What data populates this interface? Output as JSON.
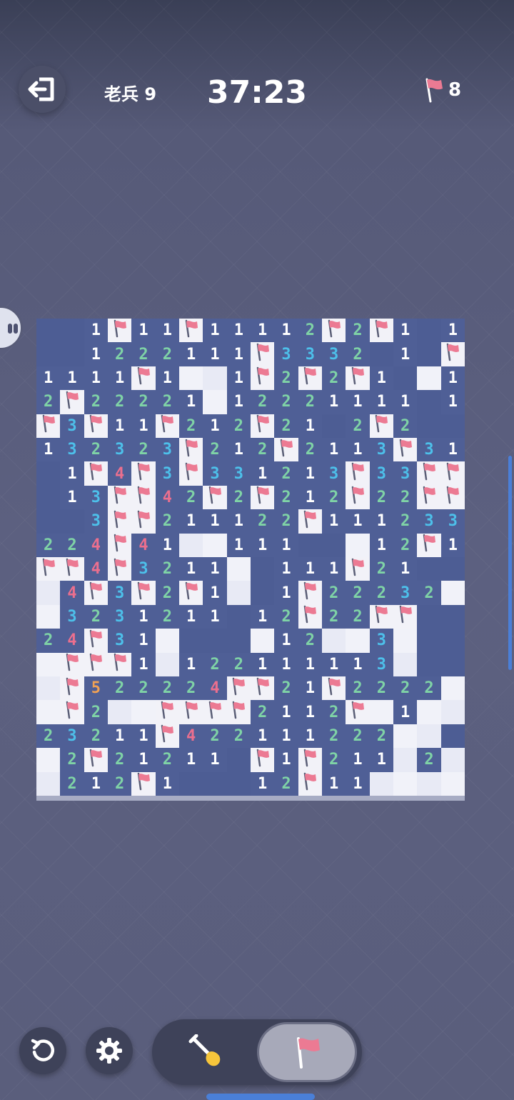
{
  "header": {
    "level_label": "老兵 9",
    "timer": "37:23",
    "flags_remaining": "8"
  },
  "icons": {
    "exit": "exit-arrow-icon",
    "flag": "flag-icon",
    "restart": "restart-icon",
    "settings": "gear-icon",
    "shovel": "shovel-icon",
    "side": "chat-icon"
  },
  "colors": {
    "board_covered": "#4d5d94",
    "cell_open": "#f1f2f9",
    "flag": "#ec7a93",
    "num1": "#ffffff",
    "num2": "#7fd3a6",
    "num3": "#4dc0ea",
    "num4": "#ec6f8e",
    "num5": "#f0a154"
  },
  "mode": {
    "options": [
      "dig",
      "flag"
    ],
    "selected": "flag"
  },
  "board": {
    "cols": 18,
    "rows": 20,
    "legend": "H=covered, F=flag, 0=open empty, 1-8=number",
    "grid": [
      "HH1F11F11112F2F1H11",
      "HH1222111F3332H1HF1",
      "1111F1001F2F2F1H011",
      "2F22221012221111H1H",
      "F3F11F212F21H2F2HH",
      "132323F212F2113F31",
      "H1F4F3F331213F33FF",
      "H13FF42F2F212F22FF",
      "HH3FF211122F111233",
      "224F4100111HH012F1",
      "FF4F32110H111F21",
      "04F3F2F10H1F2223200",
      "03231211H12F22FF",
      "24F310HHH0120030",
      "0FFF101221111130",
      "0F522224FF21F22220",
      "0F200FFFF2112F0100",
      "23211F42211122200",
      "02F21211HF1F2110200",
      "0212F1HHH12F110000"
    ]
  }
}
